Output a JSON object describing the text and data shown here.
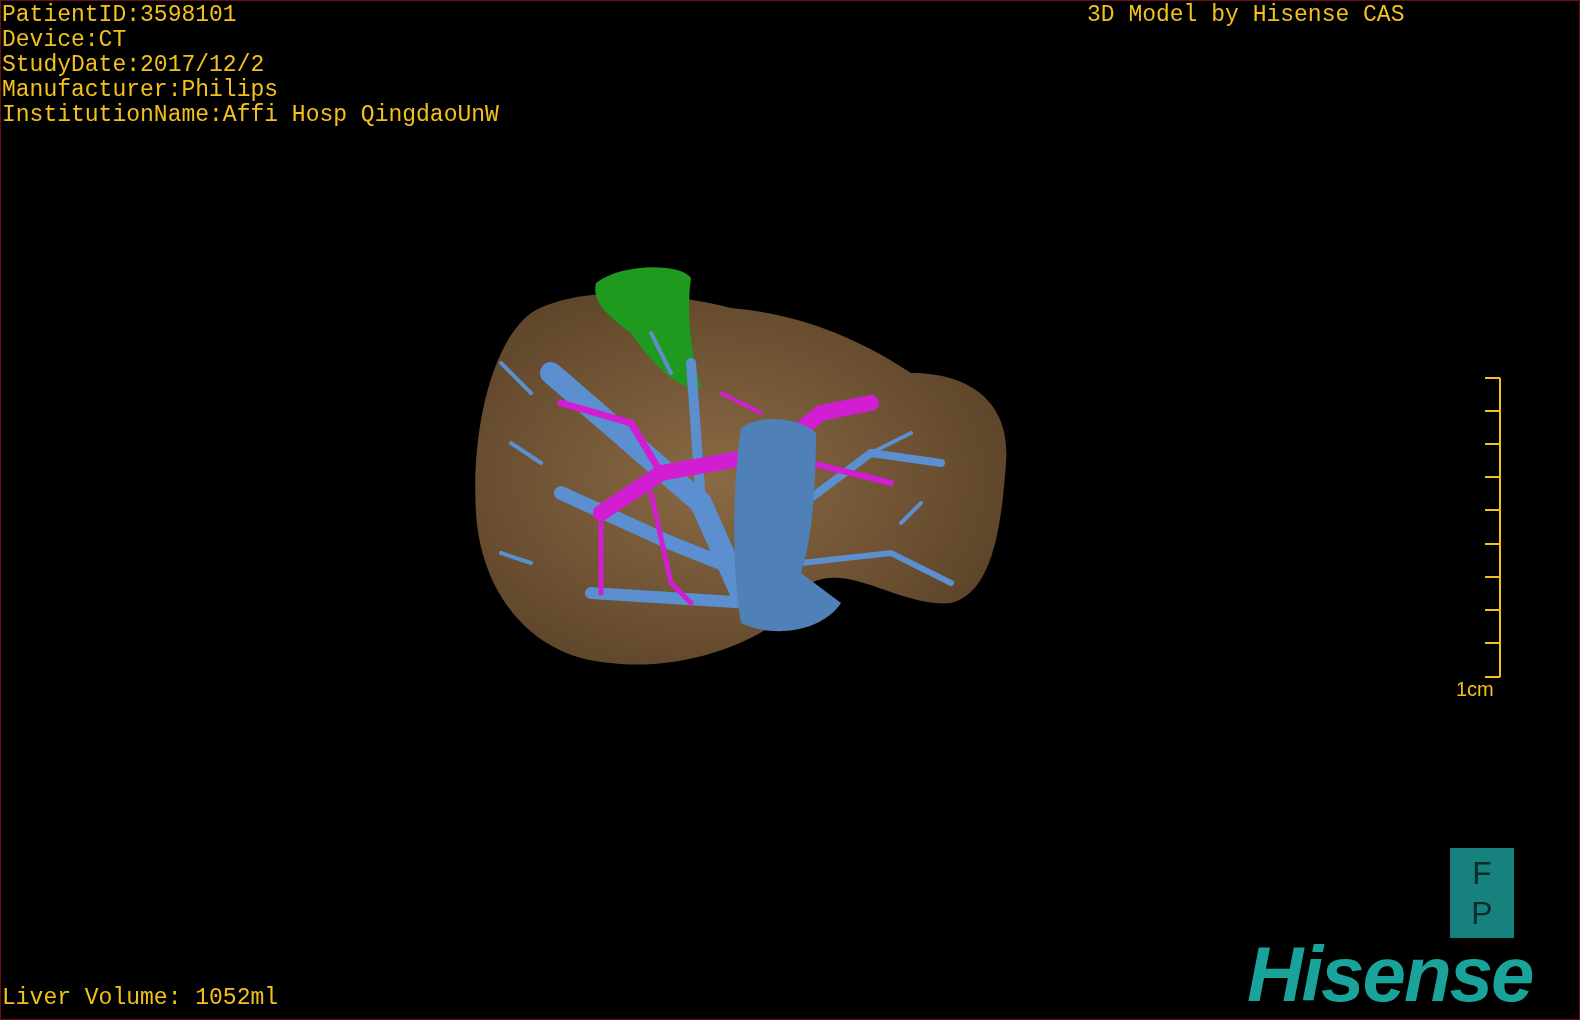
{
  "patient_info": [
    "PatientID:3598101",
    "Device:CT",
    "StudyDate:2017/12/2",
    "Manufacturer:Philips",
    "InstitutionName:Affi Hosp QingdaoUnW"
  ],
  "model_caption": "3D Model by Hisense CAS",
  "scale_bar": {
    "label": "1cm"
  },
  "orientation_marker": [
    "F",
    "P"
  ],
  "logo": "Hisense",
  "liver_volume": "Liver Volume: 1052ml"
}
